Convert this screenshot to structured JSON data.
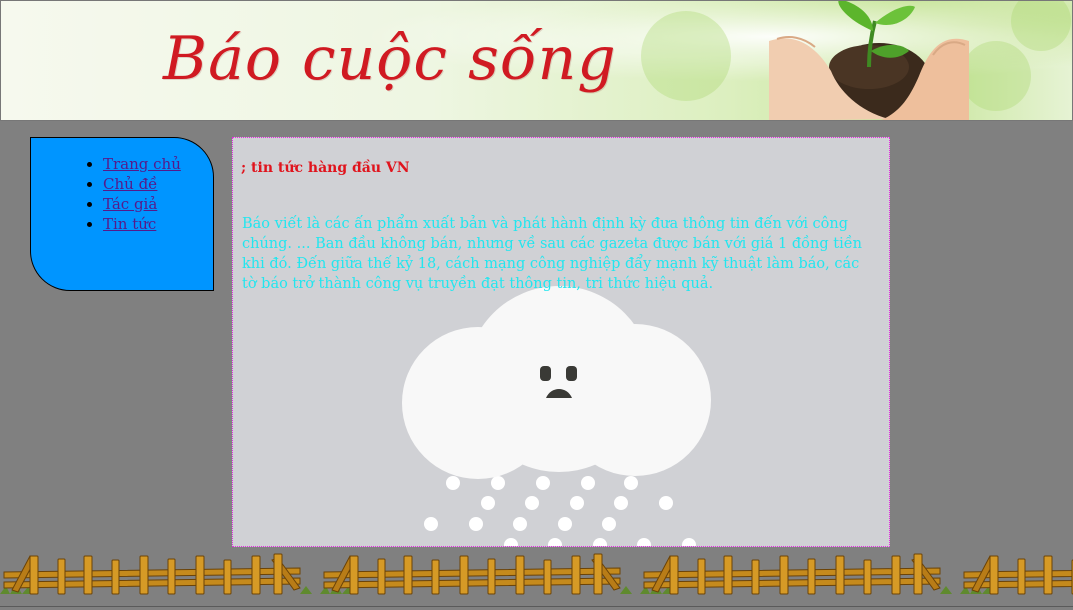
{
  "header": {
    "site_title": "Báo cuộc sống",
    "icon": "hands-holding-plant"
  },
  "sidebar": {
    "items": [
      {
        "label": "Trang chủ"
      },
      {
        "label": "Chủ đề"
      },
      {
        "label": "Tác giả"
      },
      {
        "label": "Tin tức"
      }
    ]
  },
  "main": {
    "headline": "; tin tức hàng đầu VN",
    "article": "Báo viết là các ấn phẩm xuất bản và phát hành định kỳ đưa thông tin đến với công chúng. ... Ban đầu không bán, nhưng về sau các gazeta được bán với giá 1 đồng tiền khi đó. Đến giữa thế kỷ 18, cách mạng công nghiệp đẩy mạnh kỹ thuật làm báo, các tờ báo trở thành công vụ truyền đạt thông tin, tri thức hiệu quả.",
    "illustration": "sad-rain-cloud"
  },
  "footer": {
    "decoration": "wooden-fence"
  },
  "colors": {
    "page_bg": "#808080",
    "title": "#d01a22",
    "nav_bg": "#0095ff",
    "link": "#551a8b",
    "content_bg": "#d0d1d5",
    "content_border": "#e32ae0",
    "headline": "#e0141d",
    "article_text": "#22e6ef"
  }
}
